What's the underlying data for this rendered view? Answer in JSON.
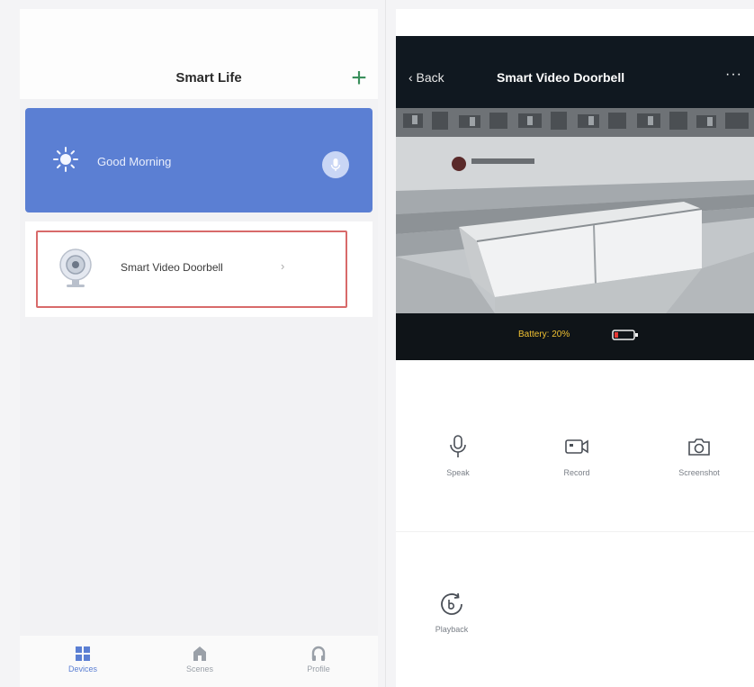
{
  "left_phone": {
    "title": "Smart Life",
    "banner": {
      "greeting": "Good Morning"
    },
    "devices": [
      {
        "name": "Smart  Video Doorbell",
        "chevron": "›"
      }
    ],
    "bottom_nav": [
      {
        "label": "Devices",
        "icon": "devices-grid-icon",
        "active": true
      },
      {
        "label": "Scenes",
        "icon": "scenes-icon",
        "active": false
      },
      {
        "label": "Profile",
        "icon": "profile-icon",
        "active": false
      }
    ]
  },
  "right_phone": {
    "back_label": "‹ Back",
    "title": "Smart  Video Doorbell",
    "more_label": "···",
    "battery_text": "Battery: 20%",
    "battery_level": 0.2,
    "controls": [
      {
        "label": "Speak",
        "icon": "microphone-icon"
      },
      {
        "label": "Record",
        "icon": "video-record-icon"
      },
      {
        "label": "Screenshot",
        "icon": "camera-icon"
      }
    ],
    "playback_label": "Playback"
  },
  "colors": {
    "banner": "#5b7fd3",
    "add_button": "#3a8f5c",
    "highlight_border": "#d86a6a",
    "dark_header": "#101820",
    "battery_text": "#f1c232",
    "battery_low": "#e53935"
  }
}
